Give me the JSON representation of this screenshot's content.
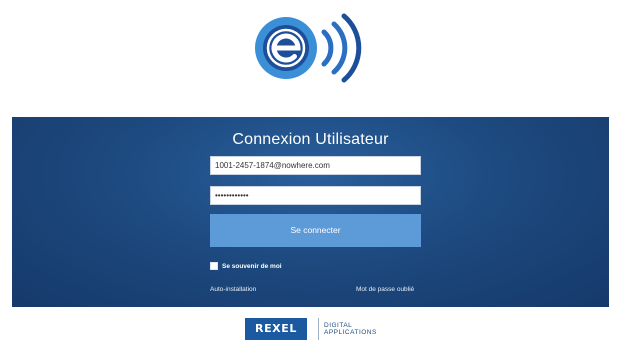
{
  "brand": {
    "colors": {
      "primary": "#1b5aa0",
      "panel": "#1d4a80",
      "button": "#5d9ad8"
    },
    "logo_icon": "e-signal-icon"
  },
  "login": {
    "title": "Connexion Utilisateur",
    "email_value": "1001-2457-1874@nowhere.com",
    "password_value": "••••••••••••",
    "submit_label": "Se connecter",
    "remember_label": "Se souvenir de moi",
    "auto_install_label": "Auto-installation",
    "forgot_label": "Mot de passe oublié"
  },
  "footer": {
    "rexel_label": "REXEL",
    "digital_line1": "DIGITAL",
    "digital_line2": "APPLICATIONS"
  }
}
